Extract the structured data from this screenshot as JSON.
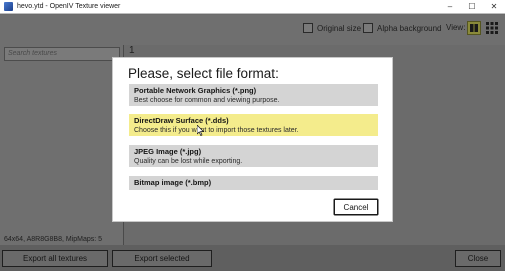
{
  "window": {
    "title": "hevo.ytd - OpenIV Texture viewer",
    "minimize": "–",
    "maximize": "☐",
    "close": "✕"
  },
  "toolbar": {
    "original_size_label": "Original size",
    "alpha_background_label": "Alpha background",
    "view_label": "View:"
  },
  "sidebar": {
    "search_placeholder": "Search textures",
    "texture_info": "64x64, A8R8G8B8, MipMaps: 5"
  },
  "main": {
    "page_number": "1"
  },
  "bottom_bar": {
    "export_all_label": "Export all textures",
    "export_selected_label": "Export selected",
    "close_label": "Close"
  },
  "dialog": {
    "title": "Please, select file format:",
    "options": [
      {
        "title": "Portable Network Graphics (*.png)",
        "description": "Best choose for common and viewing purpose."
      },
      {
        "title": "DirectDraw Surface (*.dds)",
        "description": "Choose this if you want to import those textures later."
      },
      {
        "title": "JPEG Image (*.jpg)",
        "description": "Quality can be lost while exporting."
      },
      {
        "title": "Bitmap image (*.bmp)",
        "description": ""
      }
    ],
    "selected_option": "DirectDraw Surface (*.dds)",
    "cancel_label": "Cancel"
  },
  "colors": {
    "highlight": "#f4ec8c",
    "option_bg": "#d4d4d4",
    "overlay": "#6b6b6b"
  },
  "icons": [
    "app-icon",
    "grid-large-icon",
    "grid-small-icon",
    "mouse-cursor-icon"
  ]
}
